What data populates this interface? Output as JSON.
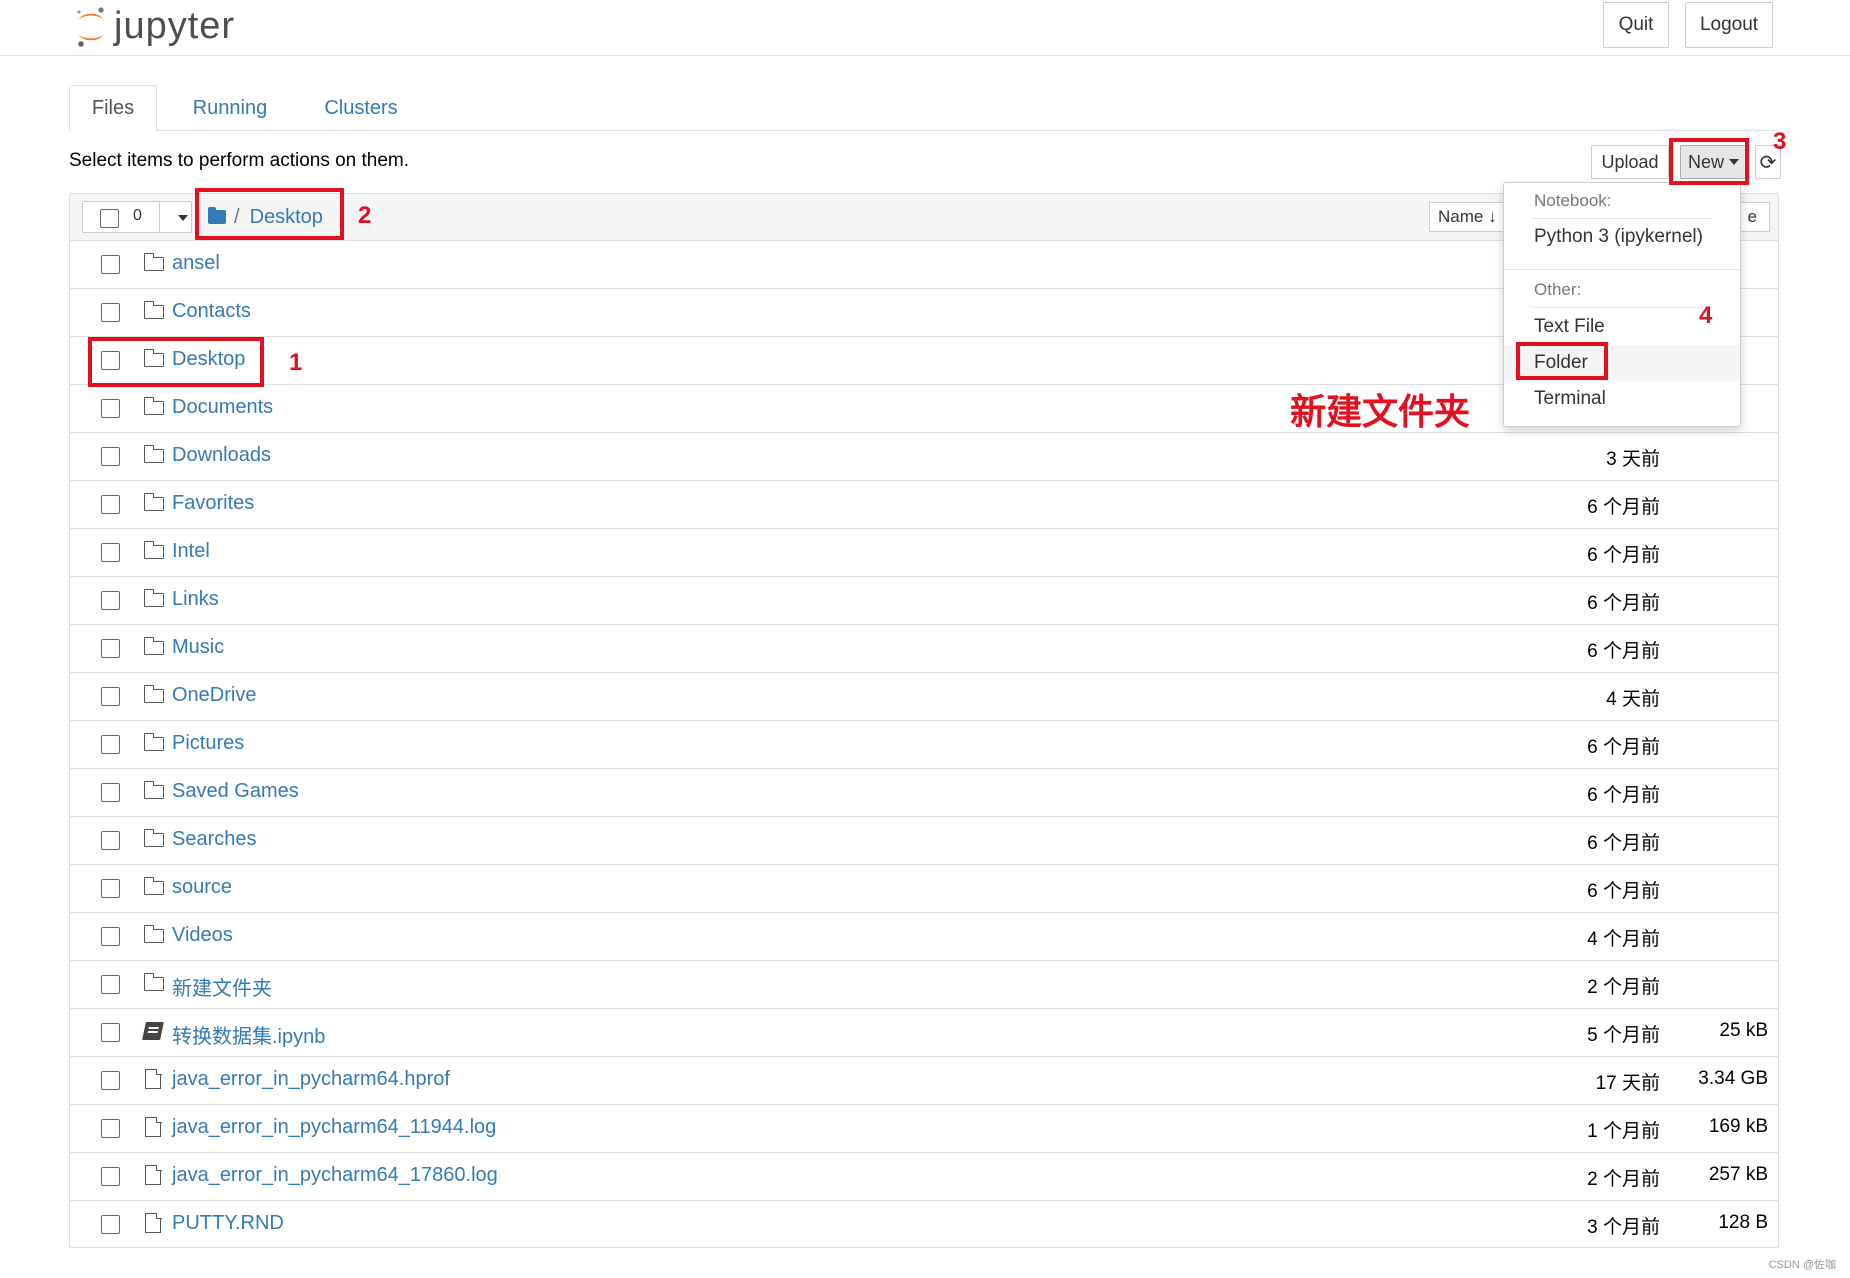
{
  "header": {
    "logo_text": "jupyter",
    "quit_label": "Quit",
    "logout_label": "Logout"
  },
  "tabs": [
    {
      "label": "Files",
      "active": true
    },
    {
      "label": "Running",
      "active": false
    },
    {
      "label": "Clusters",
      "active": false
    }
  ],
  "toolbar": {
    "hint": "Select items to perform actions on them.",
    "upload_label": "Upload",
    "new_label": "New",
    "refresh_glyph": "⟳"
  },
  "list_header": {
    "selected_count": "0",
    "breadcrumb_sep": "/",
    "breadcrumb_current": "Desktop",
    "name_sort_label": "Name ↓",
    "size_sort_label": "e"
  },
  "files": [
    {
      "name": "ansel",
      "type": "folder",
      "modified": "",
      "size": ""
    },
    {
      "name": "Contacts",
      "type": "folder",
      "modified": "",
      "size": ""
    },
    {
      "name": "Desktop",
      "type": "folder",
      "modified": "",
      "size": ""
    },
    {
      "name": "Documents",
      "type": "folder",
      "modified": "",
      "size": ""
    },
    {
      "name": "Downloads",
      "type": "folder",
      "modified": "3 天前",
      "size": ""
    },
    {
      "name": "Favorites",
      "type": "folder",
      "modified": "6 个月前",
      "size": ""
    },
    {
      "name": "Intel",
      "type": "folder",
      "modified": "6 个月前",
      "size": ""
    },
    {
      "name": "Links",
      "type": "folder",
      "modified": "6 个月前",
      "size": ""
    },
    {
      "name": "Music",
      "type": "folder",
      "modified": "6 个月前",
      "size": ""
    },
    {
      "name": "OneDrive",
      "type": "folder",
      "modified": "4 天前",
      "size": ""
    },
    {
      "name": "Pictures",
      "type": "folder",
      "modified": "6 个月前",
      "size": ""
    },
    {
      "name": "Saved Games",
      "type": "folder",
      "modified": "6 个月前",
      "size": ""
    },
    {
      "name": "Searches",
      "type": "folder",
      "modified": "6 个月前",
      "size": ""
    },
    {
      "name": "source",
      "type": "folder",
      "modified": "6 个月前",
      "size": ""
    },
    {
      "name": "Videos",
      "type": "folder",
      "modified": "4 个月前",
      "size": ""
    },
    {
      "name": "新建文件夹",
      "type": "folder",
      "modified": "2 个月前",
      "size": ""
    },
    {
      "name": "转换数据集.ipynb",
      "type": "notebook",
      "modified": "5 个月前",
      "size": "25 kB"
    },
    {
      "name": "java_error_in_pycharm64.hprof",
      "type": "file",
      "modified": "17 天前",
      "size": "3.34 GB"
    },
    {
      "name": "java_error_in_pycharm64_11944.log",
      "type": "file",
      "modified": "1 个月前",
      "size": "169 kB"
    },
    {
      "name": "java_error_in_pycharm64_17860.log",
      "type": "file",
      "modified": "2 个月前",
      "size": "257 kB"
    },
    {
      "name": "PUTTY.RND",
      "type": "file",
      "modified": "3 个月前",
      "size": "128 B"
    }
  ],
  "new_menu": {
    "notebook_header": "Notebook:",
    "kernel_item": "Python 3 (ipykernel)",
    "other_header": "Other:",
    "items": [
      "Text File",
      "Folder",
      "Terminal"
    ]
  },
  "annotations": {
    "num1": "1",
    "num2": "2",
    "num3": "3",
    "num4": "4",
    "caption": "新建文件夹"
  },
  "watermark": "CSDN @佐咖",
  "colors": {
    "link": "#337ab7",
    "annotation": "#e3101f",
    "logo_orange": "#f37626"
  }
}
